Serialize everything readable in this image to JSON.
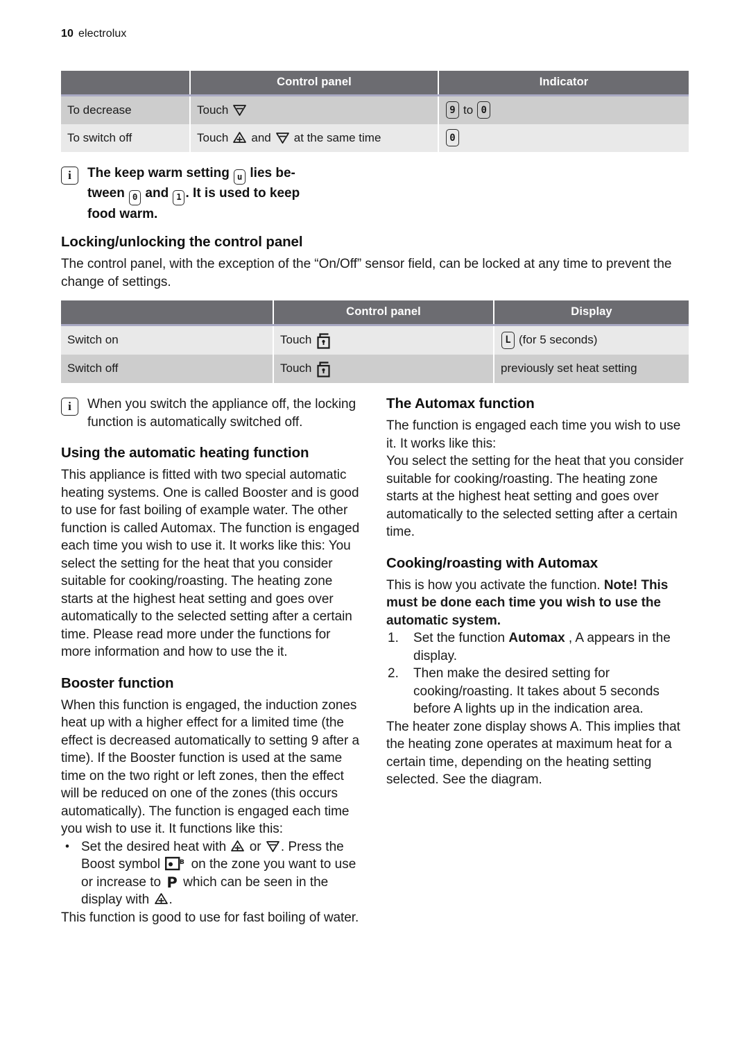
{
  "page": {
    "number": "10",
    "brand": "electrolux"
  },
  "table_heat": {
    "headers": [
      "",
      "Control panel",
      "Indicator"
    ],
    "rows": [
      {
        "action": "To decrease",
        "control_prefix": "Touch",
        "control_symbols": [
          "down-triangle"
        ],
        "control_suffix": "",
        "indicator_text_before": "",
        "indicator_glyphs": [
          "9",
          "to",
          "0"
        ]
      },
      {
        "action": "To switch off",
        "control_prefix": "Touch",
        "control_symbols": [
          "up-triangle",
          "down-triangle"
        ],
        "control_mid": "and",
        "control_suffix": "at the same time",
        "indicator_glyphs": [
          "0"
        ]
      }
    ]
  },
  "keep_warm_note": {
    "icon": "info-icon",
    "text_1": "The keep warm setting",
    "glyph_1": "u",
    "text_2": "lies be-",
    "text_3": "tween",
    "glyph_2": "0",
    "text_4": "and",
    "glyph_3": "1",
    "text_5": ". It is used to keep",
    "text_6": "food warm."
  },
  "locking": {
    "heading": "Locking/unlocking the control panel",
    "paragraph": "The control panel, with the exception of the “On/Off” sensor field, can be locked at any time to prevent the change of settings."
  },
  "table_lock": {
    "headers": [
      "",
      "Control panel",
      "Display"
    ],
    "rows": [
      {
        "action": "Switch on",
        "control_prefix": "Touch",
        "control_symbols": [
          "lock-icon"
        ],
        "display_glyph": "L",
        "display_text": "(for 5 seconds)"
      },
      {
        "action": "Switch off",
        "control_prefix": "Touch",
        "control_symbols": [
          "lock-icon"
        ],
        "display_glyph": "",
        "display_text": "previously set heat setting"
      }
    ]
  },
  "switch_off_note": {
    "icon": "info-icon",
    "text": "When you switch the appliance off, the locking function is automatically switched off."
  },
  "left_column": {
    "heading_auto": "Using the automatic heating function",
    "paragraph_auto": "This appliance is fitted with two special automatic heating systems. One is called Booster and is good to use for fast boiling of example water. The other function is called Automax. The function is engaged each time you wish to use it. It works like this: You select the setting for the heat that you consider suitable for cooking/roasting. The heating zone starts at the highest heat setting and goes over automatically to the selected setting after a certain time. Please read more under the functions for more information and how to use the it.",
    "heading_booster": "Booster function",
    "paragraph_booster": "When this function is engaged, the induction zones heat up with a higher effect for a limited time (the effect is decreased automatically to setting 9 after a time). If the Booster function is used at the same time on the two right or left zones, then the effect will be reduced on one of the zones (this occurs automatically). The function is engaged each time you wish to use it. It functions like this:",
    "bullet": {
      "part_1": "Set the desired heat with",
      "symbol_1": "up-triangle",
      "part_2": "or",
      "symbol_2": "down-triangle",
      "part_3": ". Press the Boost symbol",
      "symbol_3": "boost-icon",
      "part_4": "on the zone you want to use or increase to",
      "symbol_4": "P",
      "part_5": "which can be seen in the display with",
      "symbol_5": "up-triangle",
      "part_6": "."
    },
    "paragraph_closing": "This function is good to use for fast boiling of water."
  },
  "right_column": {
    "heading_automax": "The Automax function",
    "paragraph_1": "The function is engaged each time you wish to use it. It works like this:",
    "paragraph_2": "You select the setting for the heat that you consider suitable for cooking/roasting. The heating zone starts at the highest heat setting and goes over automatically to the selected setting after a certain time.",
    "heading_cooking": "Cooking/roasting with Automax",
    "intro_normal": "This is how you activate the function.",
    "intro_bold": "Note! This must be done each time you wish to use the automatic system.",
    "steps": [
      {
        "marker": "1.",
        "text_before": "Set the function",
        "bold": "Automax",
        "text_after": ", A appears in the display."
      },
      {
        "marker": "2.",
        "text_before": "Then make the desired setting for cooking/roasting. It takes about 5 seconds before A lights up in the indication area.",
        "bold": "",
        "text_after": ""
      }
    ],
    "paragraph_closing": "The heater zone display shows A. This implies that the heating zone operates at maximum heat for a certain time, depending on the heating setting selected. See the diagram."
  },
  "colors": {
    "table_header_bg": "#6c6c71",
    "table_header_rule": "#a9a9c3",
    "row_dark": "#cdcdcd",
    "row_light": "#e9e9e9",
    "text": "#1a1a1a"
  }
}
